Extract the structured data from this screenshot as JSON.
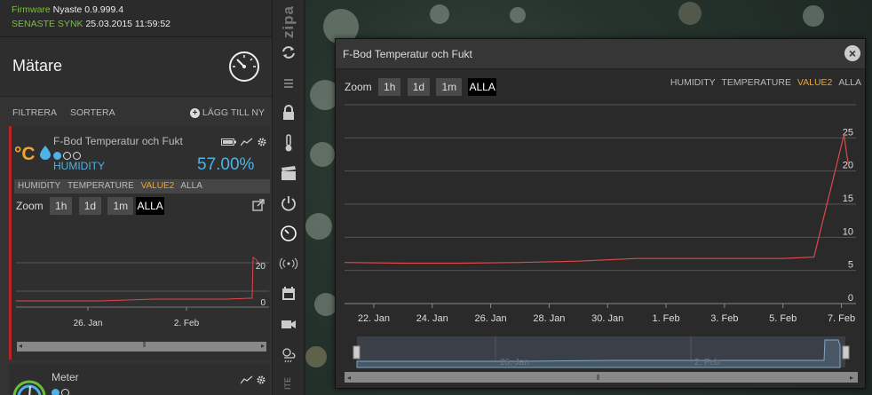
{
  "top": {
    "firmware_label": "Firmware",
    "firmware_value": "Nyaste 0.9.999.4",
    "sync_label": "SENASTE SYNK",
    "sync_value": "25.03.2015 11:59:52"
  },
  "meters": {
    "title": "Mätare",
    "filter_label": "FILTRERA",
    "sort_label": "SORTERA",
    "add_label": "LÄGG TILL NY"
  },
  "card": {
    "title": "F-Bod Temperatur och Fukt",
    "type_icon": "°C",
    "series_label": "HUMIDITY",
    "value": "57.00%",
    "series_tabs": [
      "HUMIDITY",
      "TEMPERATURE",
      "VALUE2",
      "ALLA"
    ],
    "active_series_tab": "VALUE2",
    "zoom_label": "Zoom",
    "zoom_buttons": [
      "1h",
      "1d",
      "1m",
      "ALLA"
    ],
    "selected_zoom": "ALLA"
  },
  "meter2": {
    "title": "Meter"
  },
  "strip": {
    "brand": "zipa",
    "bottom_label": "ITE"
  },
  "window": {
    "title": "F-Bod Temperatur och Fukt",
    "zoom_label": "Zoom",
    "zoom_buttons": [
      "1h",
      "1d",
      "1m",
      "ALLA"
    ],
    "selected_zoom": "ALLA",
    "legend": [
      "HUMIDITY",
      "TEMPERATURE",
      "VALUE2",
      "ALLA"
    ],
    "active_legend": "VALUE2"
  },
  "colors": {
    "accent_orange": "#f0a52a",
    "humidity_blue": "#4db2e6",
    "line_red": "#e0484a",
    "firmware_green": "#7cbf3c"
  },
  "chart_data": [
    {
      "type": "line",
      "name": "main",
      "x": [
        "2015-01-21",
        "2015-01-23",
        "2015-01-25",
        "2015-01-27",
        "2015-01-29",
        "2015-01-30",
        "2015-01-31",
        "2015-02-01",
        "2015-02-03",
        "2015-02-05",
        "2015-02-06",
        "2015-02-06",
        "2015-02-07",
        "2015-02-07",
        "2015-02-07"
      ],
      "values": [
        6.2,
        6.1,
        6.1,
        6.2,
        6.4,
        6.6,
        6.8,
        6.8,
        6.8,
        6.8,
        7.0,
        7.0,
        25.5,
        22.5,
        21.0
      ],
      "x_ticks": [
        "22. Jan",
        "24. Jan",
        "26. Jan",
        "28. Jan",
        "30. Jan",
        "1. Feb",
        "3. Feb",
        "5. Feb",
        "7. Feb"
      ],
      "y_ticks": [
        0,
        5,
        10,
        15,
        20,
        25
      ],
      "ylim": [
        0,
        30
      ],
      "grid": true
    },
    {
      "type": "line",
      "name": "card-mini",
      "x_ticks": [
        "26. Jan",
        "2. Feb"
      ],
      "y_ticks": [
        0,
        20
      ],
      "ylim": [
        0,
        30
      ],
      "grid": true
    },
    {
      "type": "area",
      "name": "navigator",
      "x_ticks": [
        "26. Jan",
        "2. Feb"
      ]
    }
  ]
}
